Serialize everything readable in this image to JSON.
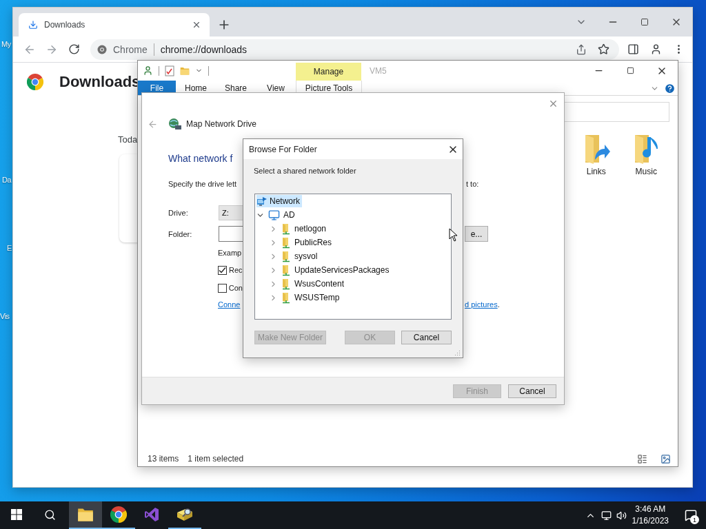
{
  "desktop": {
    "icon_labels": [
      "My",
      "Da",
      "E",
      "Vis"
    ]
  },
  "browser": {
    "tabs": [
      {
        "title": "Downloads",
        "selected": true
      }
    ],
    "address_bar": {
      "site_chip": "Chrome",
      "url": "chrome://downloads"
    },
    "page": {
      "title": "Downloads",
      "section": "Toda"
    }
  },
  "explorer": {
    "contextual_header": "Manage",
    "title": "VM5",
    "ribbon_tabs": [
      {
        "label": "File",
        "kind": "file"
      },
      {
        "label": "Home",
        "kind": "tab"
      },
      {
        "label": "Share",
        "kind": "tab"
      },
      {
        "label": "View",
        "kind": "tab"
      },
      {
        "label": "Picture Tools",
        "kind": "contextual"
      }
    ],
    "folders": [
      {
        "name": "Links",
        "kind": "shortcut"
      },
      {
        "name": "Music",
        "kind": "music"
      }
    ],
    "status": {
      "item_count": "13 items",
      "selection": "1 item selected"
    }
  },
  "map_drive": {
    "title": "Map Network Drive",
    "heading": "What network f",
    "instruction": "Specify the drive lett",
    "instruction_end": "t to:",
    "fields": [
      {
        "label": "Drive:",
        "value": "Z:",
        "kind": "select"
      },
      {
        "label": "Folder:",
        "kind": "input"
      }
    ],
    "browse_button": "e...",
    "example": "Examp",
    "options": [
      {
        "label": "Rec",
        "checked": true
      },
      {
        "label": "Con",
        "checked": false
      }
    ],
    "link_start": "Conne",
    "link_end": "d pictures",
    "link_end_suffix": ".",
    "buttons": [
      {
        "label": "Finish",
        "disabled": true
      },
      {
        "label": "Cancel",
        "disabled": false
      }
    ]
  },
  "browse_dialog": {
    "title": "Browse For Folder",
    "prompt": "Select a shared network folder",
    "tree": [
      {
        "label": "Network",
        "kind": "network",
        "selected": true,
        "children": [
          {
            "label": "AD",
            "kind": "computer",
            "selected": false,
            "expanded": true,
            "children": [
              {
                "label": "netlogon",
                "kind": "share",
                "selected": false,
                "expanded": false
              },
              {
                "label": "PublicRes",
                "kind": "share",
                "selected": false,
                "expanded": false
              },
              {
                "label": "sysvol",
                "kind": "share",
                "selected": false,
                "expanded": false
              },
              {
                "label": "UpdateServicesPackages",
                "kind": "share",
                "selected": false,
                "expanded": false
              },
              {
                "label": "WsusContent",
                "kind": "share",
                "selected": false,
                "expanded": false
              },
              {
                "label": "WSUSTemp",
                "kind": "share",
                "selected": false,
                "expanded": false
              }
            ]
          }
        ]
      }
    ],
    "buttons": [
      {
        "label": "Make New Folder",
        "disabled": true
      },
      {
        "label": "OK",
        "disabled": true
      },
      {
        "label": "Cancel",
        "disabled": false
      }
    ]
  },
  "taskbar": {
    "apps": [
      {
        "kind": "explorer",
        "selected": true,
        "running": true
      },
      {
        "kind": "chrome",
        "selected": false,
        "running": true
      },
      {
        "kind": "studio",
        "selected": false,
        "running": false
      },
      {
        "kind": "tool",
        "selected": false,
        "running": true
      }
    ],
    "clock": {
      "time": "3:46 AM",
      "date": "1/16/2023"
    },
    "notifications": {
      "count": "1"
    }
  }
}
